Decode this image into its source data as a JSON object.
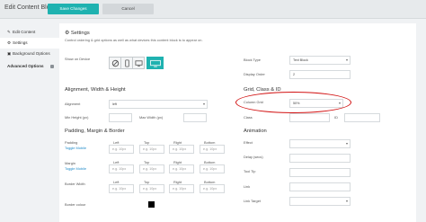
{
  "header": {
    "title": "Edit Content Block",
    "save_label": "Save Changes",
    "cancel_label": "Cancel"
  },
  "sidebar": {
    "items": [
      {
        "label": "Edit Content",
        "icon": "edit-icon"
      },
      {
        "label": "Settings",
        "icon": "gear-icon"
      },
      {
        "label": "Background Options",
        "icon": "image-icon"
      },
      {
        "label": "Advanced Options",
        "icon": "expand-icon"
      }
    ]
  },
  "settings": {
    "title": "Settings",
    "description": "Control ordering & grid options as well as what devices this content block is to appear on.",
    "show_on_device_label": "Show on Device",
    "block_type_label": "Block Type",
    "block_type_value": "Text Block",
    "display_order_label": "Display Order",
    "display_order_value": "2"
  },
  "alignment": {
    "title": "Alignment, Width & Height",
    "alignment_label": "Alignment",
    "alignment_value": "left",
    "width_label": "Width",
    "min_height_label": "Min Height (px)",
    "max_width_label": "Max Width (px)"
  },
  "grid": {
    "title": "Grid, Class & ID",
    "column_grid_label": "Column Grid",
    "column_grid_value": "50%",
    "class_label": "Class",
    "id_label": "ID"
  },
  "padding": {
    "title": "Padding, Margin & Border",
    "padding_label": "Padding",
    "margin_label": "Margin",
    "toggle_label": "Toggle Mobile",
    "border_width_label": "Border Width",
    "border_colour_label": "Border colour",
    "border_colour": "#000000",
    "col_left": "Left",
    "col_top": "Top",
    "col_right": "Right",
    "col_bottom": "Bottom",
    "placeholder": "e.g. 10px"
  },
  "animation": {
    "title": "Animation",
    "effect_label": "Effect",
    "delay_label": "Delay (secs)",
    "tool_tip_label": "Tool Tip",
    "link_label": "Link",
    "link_target_label": "Link Target"
  }
}
